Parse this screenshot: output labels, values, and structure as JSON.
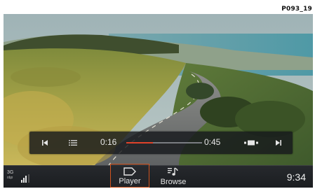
{
  "figure_code": "P093_19",
  "player": {
    "elapsed": "0:16",
    "total": "0:45",
    "progress_fraction": 0.356
  },
  "status": {
    "network": "3G",
    "network_sub": "nbp",
    "signal_bars": 3
  },
  "tabs": [
    {
      "label": "Player",
      "icon": "player-icon",
      "active": true
    },
    {
      "label": "Browse",
      "icon": "music-note-icon",
      "active": false
    }
  ],
  "clock": "9:34",
  "colors": {
    "accent": "#e0422a",
    "active_tab_border": "#d2541f",
    "overlay_bg": "#16181c"
  },
  "icons": [
    "skip-previous-icon",
    "playlist-icon",
    "display-mode-icon",
    "skip-next-icon"
  ]
}
